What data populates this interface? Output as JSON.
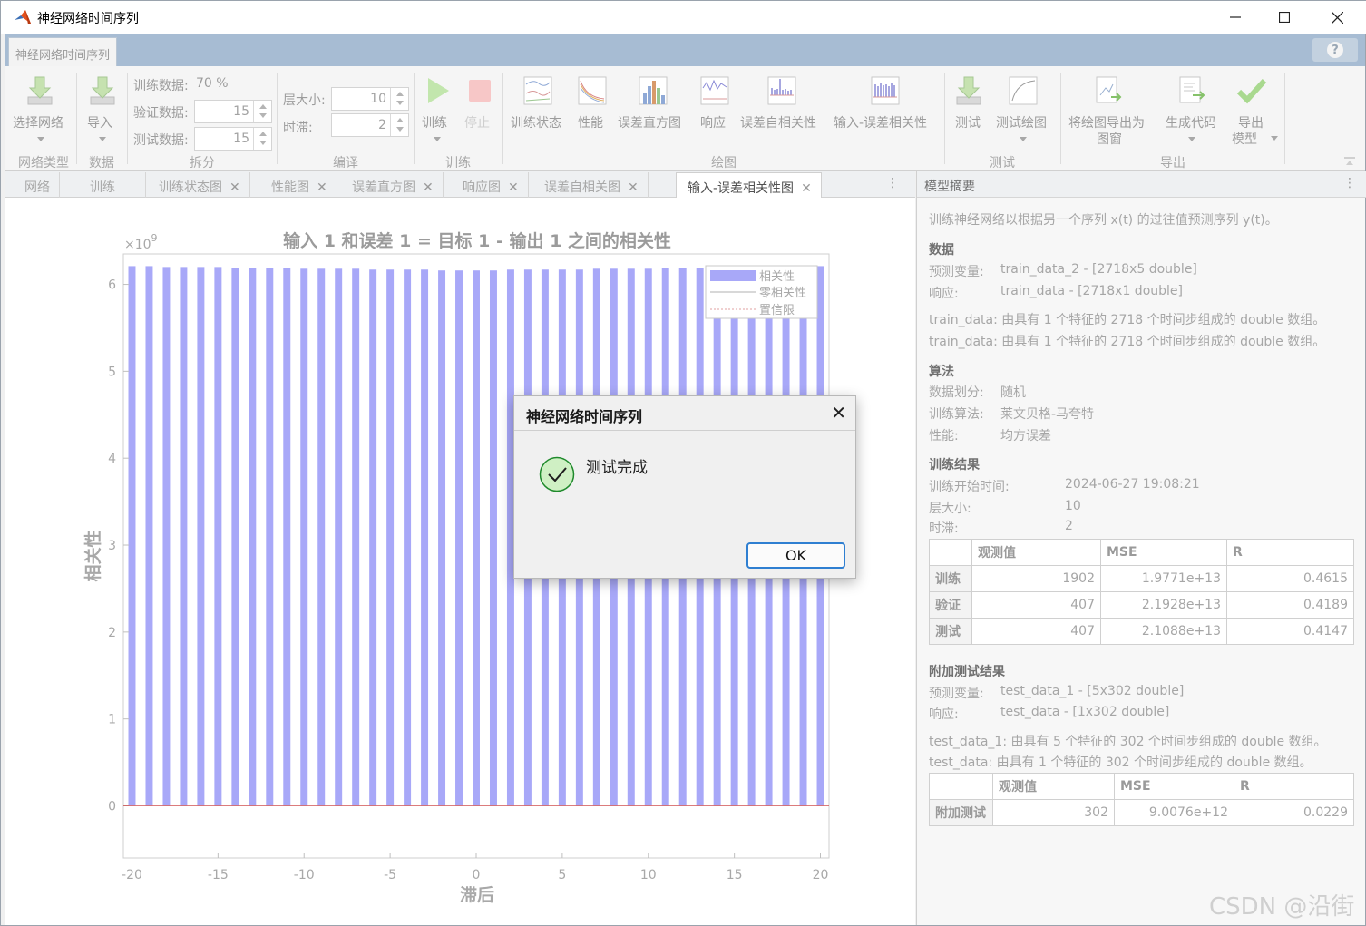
{
  "window": {
    "title": "神经网络时间序列"
  },
  "app_tab": "神经网络时间序列",
  "help": "?",
  "toolstrip": {
    "select_network": "选择网络",
    "import": "导入",
    "training_data": "训练数据:",
    "training_value": "70 %",
    "validation_data": "验证数据:",
    "validation_value": "15",
    "test_data": "测试数据:",
    "test_value": "15",
    "layer_size": "层大小:",
    "layer_value": "10",
    "delay": "时滞:",
    "delay_value": "2",
    "train": "训练",
    "stop": "停止",
    "plot_buttons": [
      "训练状态",
      "性能",
      "误差直方图",
      "响应",
      "误差自相关性",
      "输入-误差相关性"
    ],
    "test": "测试",
    "test_plot": "测试绘图",
    "export_plot_1": "将绘图导出为",
    "export_plot_2": "图窗",
    "generate_code": "生成代码",
    "export_model_1": "导出",
    "export_model_2": "模型",
    "sections": {
      "network_type": "网络类型",
      "data": "数据",
      "split": "拆分",
      "compile": "编译",
      "training": "训练",
      "plots": "绘图",
      "testing": "测试",
      "export": "导出"
    }
  },
  "doc_tabs": [
    "网络",
    "训练",
    "训练状态图",
    "性能图",
    "误差直方图",
    "响应图",
    "误差自相关图",
    "输入-误差相关性图"
  ],
  "close_mark": "✕",
  "more": "⋮",
  "chart_data": {
    "type": "bar",
    "title": "输入 1 和误差 1 = 目标 1 - 输出 1 之间的相关性",
    "xlabel": "滞后",
    "ylabel": "相关性",
    "exponent_label": "×10",
    "exponent_power": "9",
    "xlim": [
      -20.5,
      20.5
    ],
    "ylim": [
      -0.6,
      6.35
    ],
    "xticks": [
      "-20",
      "-15",
      "-10",
      "-5",
      "0",
      "5",
      "10",
      "15",
      "20"
    ],
    "yticks": [
      "0",
      "1",
      "2",
      "3",
      "4",
      "5",
      "6"
    ],
    "legend": [
      "相关性",
      "零相关性",
      "置信限"
    ],
    "legend_position": "top-right",
    "bar_color": "#a8a8f8",
    "x": [
      -20,
      -19,
      -18,
      -17,
      -16,
      -15,
      -14,
      -13,
      -12,
      -11,
      -10,
      -9,
      -8,
      -7,
      -6,
      -5,
      -4,
      -3,
      -2,
      -1,
      0,
      1,
      2,
      3,
      4,
      5,
      6,
      7,
      8,
      9,
      10,
      11,
      12,
      13,
      14,
      15,
      16,
      17,
      18,
      19,
      20
    ],
    "values": [
      6.21,
      6.21,
      6.2,
      6.2,
      6.2,
      6.2,
      6.19,
      6.19,
      6.19,
      6.19,
      6.18,
      6.18,
      6.18,
      6.18,
      6.17,
      6.17,
      6.17,
      6.17,
      6.16,
      6.16,
      6.16,
      6.16,
      6.17,
      6.17,
      6.17,
      6.17,
      6.17,
      6.18,
      6.18,
      6.18,
      6.18,
      6.19,
      6.19,
      6.19,
      6.19,
      6.2,
      6.2,
      6.2,
      6.2,
      6.2,
      6.21
    ]
  },
  "summary": {
    "header": "模型摘要",
    "intro": "训练神经网络以根据另一个序列 x(t) 的过往值预测序列 y(t)。",
    "data_title": "数据",
    "predictor_label": "预测变量:",
    "predictor_value": "train_data_2 - [2718x5 double]",
    "response_label": "响应:",
    "response_value": "train_data - [2718x1 double]",
    "data_desc_1": "train_data: 由具有 1 个特征的 2718 个时间步组成的 double 数组。",
    "data_desc_2": "train_data: 由具有 1 个特征的 2718 个时间步组成的 double 数组。",
    "algo_title": "算法",
    "split_label": "数据划分:",
    "split_value": "随机",
    "algo_label": "训练算法:",
    "algo_value": "莱文贝格-马夸特",
    "perf_label": "性能:",
    "perf_value": "均方误差",
    "results_title": "训练结果",
    "start_label": "训练开始时间:",
    "start_value": "2024-06-27 19:08:21",
    "layer_label": "层大小:",
    "layer_value": "10",
    "delay_label": "时滞:",
    "delay_value": "2",
    "table_headers": [
      "观测值",
      "MSE",
      "R"
    ],
    "rows": [
      {
        "name": "训练",
        "obs": "1902",
        "mse": "1.9771e+13",
        "r": "0.4615"
      },
      {
        "name": "验证",
        "obs": "407",
        "mse": "2.1928e+13",
        "r": "0.4189"
      },
      {
        "name": "测试",
        "obs": "407",
        "mse": "2.1088e+13",
        "r": "0.4147"
      }
    ],
    "extra_title": "附加测试结果",
    "extra_predictor_label": "预测变量:",
    "extra_predictor_value": "test_data_1 - [5x302 double]",
    "extra_response_label": "响应:",
    "extra_response_value": "test_data - [1x302 double]",
    "extra_desc_1": "test_data_1: 由具有 5 个特征的 302 个时间步组成的 double 数组。",
    "extra_desc_2": "test_data: 由具有 1 个特征的 302 个时间步组成的 double 数组。",
    "extra_row": {
      "name": "附加测试",
      "obs": "302",
      "mse": "9.0076e+12",
      "r": "0.0229"
    }
  },
  "dialog": {
    "title": "神经网络时间序列",
    "message": "测试完成",
    "ok": "OK",
    "close": "✕"
  },
  "watermark": "CSDN @沿街"
}
